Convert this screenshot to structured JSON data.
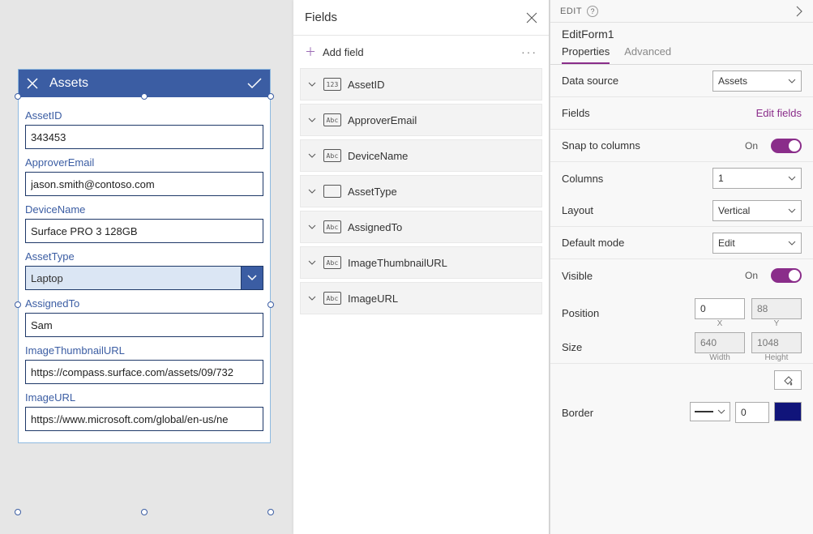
{
  "form": {
    "title": "Assets",
    "fields": {
      "assetid": {
        "label": "AssetID",
        "value": "343453"
      },
      "approver": {
        "label": "ApproverEmail",
        "value": "jason.smith@contoso.com"
      },
      "device": {
        "label": "DeviceName",
        "value": "Surface PRO 3 128GB"
      },
      "assettype": {
        "label": "AssetType",
        "value": "Laptop"
      },
      "assigned": {
        "label": "AssignedTo",
        "value": "Sam"
      },
      "thumb": {
        "label": "ImageThumbnailURL",
        "value": "https://compass.surface.com/assets/09/732"
      },
      "image": {
        "label": "ImageURL",
        "value": "https://www.microsoft.com/global/en-us/ne"
      }
    }
  },
  "fields_panel": {
    "title": "Fields",
    "add_label": "Add field",
    "items": [
      {
        "type_icon": "num",
        "label": "AssetID"
      },
      {
        "type_icon": "abc",
        "label": "ApproverEmail"
      },
      {
        "type_icon": "abc",
        "label": "DeviceName"
      },
      {
        "type_icon": "choice",
        "label": "AssetType"
      },
      {
        "type_icon": "abc",
        "label": "AssignedTo"
      },
      {
        "type_icon": "abc",
        "label": "ImageThumbnailURL"
      },
      {
        "type_icon": "abc",
        "label": "ImageURL"
      }
    ]
  },
  "props": {
    "edit_label": "EDIT",
    "component_name": "EditForm1",
    "tabs": {
      "properties": "Properties",
      "advanced": "Advanced"
    },
    "data_source": {
      "label": "Data source",
      "value": "Assets"
    },
    "fields_row": {
      "label": "Fields",
      "link": "Edit fields"
    },
    "snap": {
      "label": "Snap to columns",
      "state": "On"
    },
    "columns": {
      "label": "Columns",
      "value": "1"
    },
    "layout": {
      "label": "Layout",
      "value": "Vertical"
    },
    "default_mode": {
      "label": "Default mode",
      "value": "Edit"
    },
    "visible": {
      "label": "Visible",
      "state": "On"
    },
    "position": {
      "label": "Position",
      "x": "0",
      "y": "88",
      "xlabel": "X",
      "ylabel": "Y"
    },
    "size": {
      "label": "Size",
      "w": "640",
      "h": "1048",
      "wlabel": "Width",
      "hlabel": "Height"
    },
    "color": {
      "label": "Color"
    },
    "border": {
      "label": "Border",
      "width": "0",
      "color": "#10147a"
    }
  }
}
